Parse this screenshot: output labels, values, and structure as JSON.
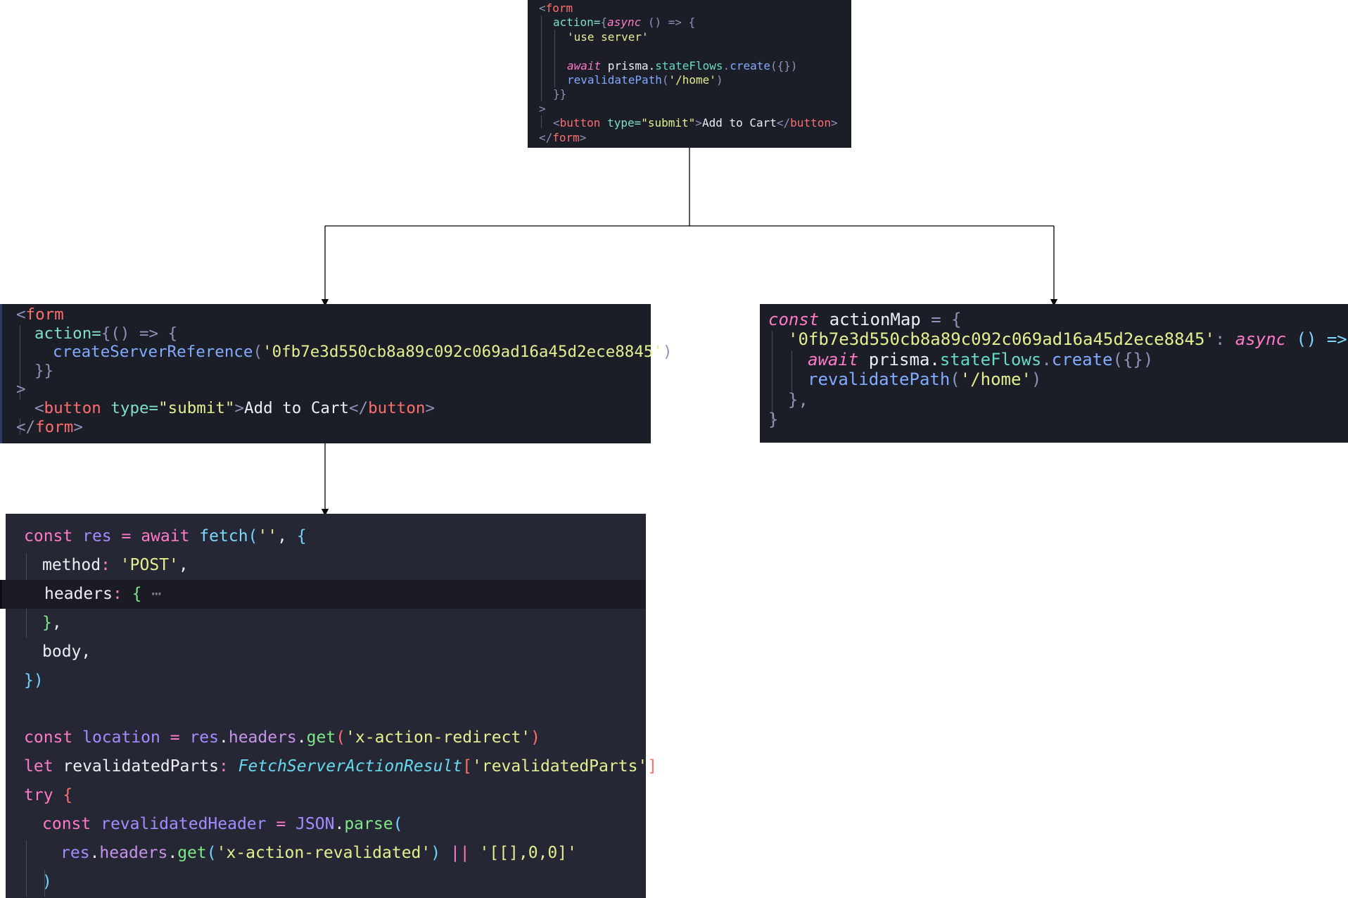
{
  "top_panel": {
    "lines": [
      [
        "<",
        "form"
      ],
      [
        "action=",
        "{",
        "async",
        " () => {"
      ],
      [
        "'use server'"
      ],
      [
        ""
      ],
      [
        "await",
        " prisma.",
        "stateFlows",
        ".",
        "create",
        "({})"
      ],
      [
        "revalidatePath",
        "(",
        "'/home'",
        ")"
      ],
      [
        "}}"
      ],
      [
        ">"
      ],
      [
        "<",
        "button",
        " type=",
        "\"submit\"",
        ">",
        "Add to Cart",
        "</",
        "button",
        ">"
      ],
      [
        "</",
        "form",
        ">"
      ]
    ]
  },
  "left_panel": {
    "lines": [
      [
        "<",
        "form"
      ],
      [
        "action=",
        "{() => {"
      ],
      [
        "createServerReference",
        "(",
        "'0fb7e3d550cb8a89c092c069ad16a45d2ece8845'",
        ")"
      ],
      [
        "}}"
      ],
      [
        ">"
      ],
      [
        "<",
        "button",
        " type=",
        "\"submit\"",
        ">",
        "Add to Cart",
        "</",
        "button",
        ">"
      ],
      [
        "</",
        "form",
        ">"
      ]
    ]
  },
  "right_panel": {
    "lines": [
      [
        "const",
        " actionMap ",
        "=",
        " {"
      ],
      [
        "'0fb7e3d550cb8a89c092c069ad16a45d2ece8845'",
        ":",
        " async",
        " () => {"
      ],
      [
        "await",
        " prisma.",
        "stateFlows",
        ".",
        "create",
        "({})"
      ],
      [
        "revalidatePath",
        "(",
        "'/home'",
        ")"
      ],
      [
        "},"
      ],
      [
        "}"
      ]
    ]
  },
  "bottom_panel": {
    "lines": [
      [
        "const",
        " res ",
        "=",
        " await",
        " fetch",
        "(",
        "''",
        ",",
        " {"
      ],
      [
        "method",
        ":",
        " 'POST'",
        ","
      ],
      [
        "headers",
        ":",
        " {",
        "⋯"
      ],
      [
        "}",
        ","
      ],
      [
        "body",
        ","
      ],
      [
        "})"
      ],
      [
        ""
      ],
      [
        "const",
        " location ",
        "=",
        " res",
        ".",
        "headers",
        ".",
        "get",
        "(",
        "'x-action-redirect'",
        ")"
      ],
      [
        "let",
        " revalidatedParts",
        ":",
        " FetchServerActionResult",
        "[",
        "'revalidatedParts'",
        "]"
      ],
      [
        "try",
        " {"
      ],
      [
        "const",
        " revalidatedHeader ",
        "=",
        " JSON",
        ".",
        "parse",
        "("
      ],
      [
        "res",
        ".",
        "headers",
        ".",
        "get",
        "(",
        "'x-action-revalidated'",
        ")",
        " ||",
        " '[[],0,0]'"
      ],
      [
        ")"
      ]
    ]
  }
}
